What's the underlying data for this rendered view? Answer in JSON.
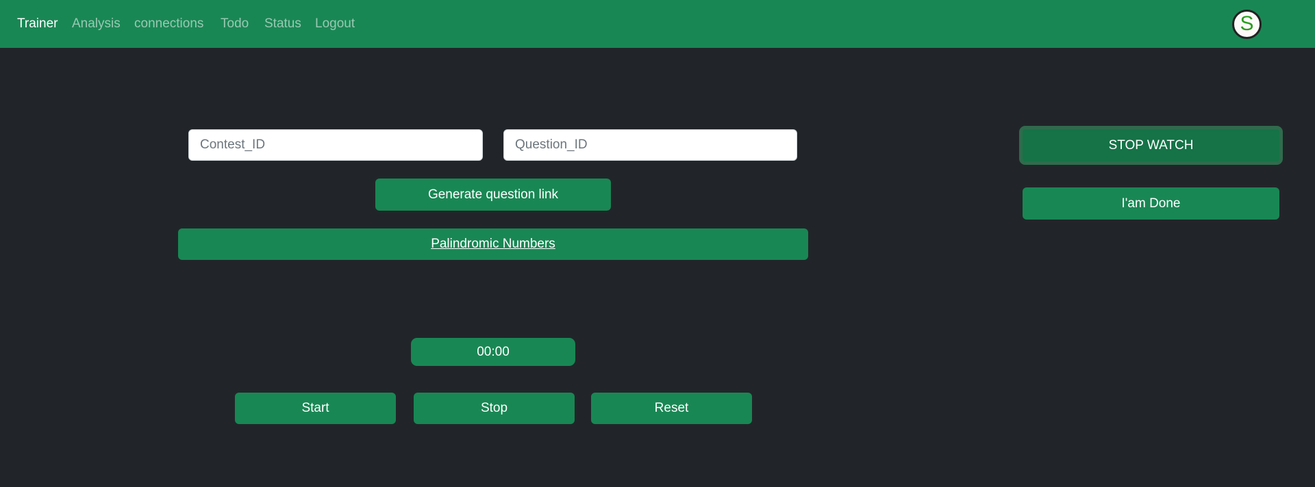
{
  "nav": {
    "items": [
      "Trainer",
      "Analysis",
      "connections",
      "Todo",
      "Status",
      "Logout"
    ],
    "avatar_letter": "S"
  },
  "form": {
    "contest_placeholder": "Contest_ID",
    "question_placeholder": "Question_ID",
    "generate_label": "Generate question link",
    "question_link": "Palindromic Numbers"
  },
  "timer": {
    "display": "00:00",
    "start": "Start",
    "stop": "Stop",
    "reset": "Reset"
  },
  "side": {
    "stopwatch": "STOP WATCH",
    "done": "I'am Done"
  },
  "colors": {
    "brand": "#198754",
    "background": "#212529"
  }
}
